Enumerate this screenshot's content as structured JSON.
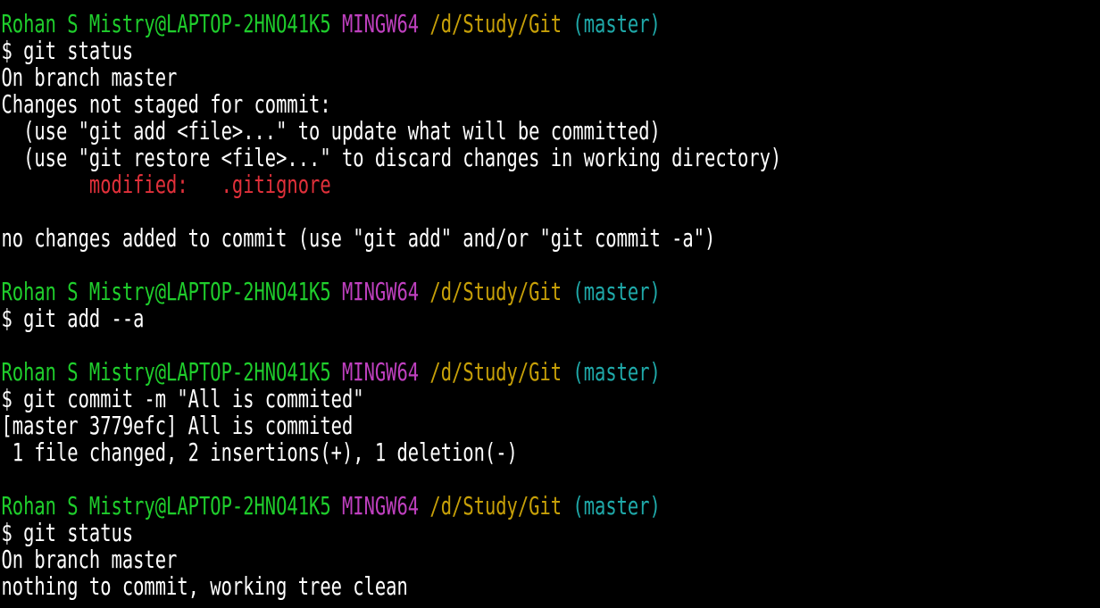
{
  "colors": {
    "background": "#000000",
    "text": "#ffffff",
    "user_host": "#1fce2c",
    "msystem": "#bf40bf",
    "path": "#c7a008",
    "branch": "#1fa9a9",
    "modified": "#e0303a"
  },
  "prompt": {
    "user_host": "Rohan S Mistry@LAPTOP-2HNO41K5",
    "msystem": "MINGW64",
    "path": "/d/Study/Git",
    "branch": "(master)"
  },
  "lines": {
    "l1": "$ git status",
    "l2": "On branch master",
    "l3": "Changes not staged for commit:",
    "l4": "  (use \"git add <file>...\" to update what will be committed)",
    "l5": "  (use \"git restore <file>...\" to discard changes in working directory)",
    "l6_label": "modified:",
    "l6_file": ".gitignore",
    "l7": "no changes added to commit (use \"git add\" and/or \"git commit -a\")",
    "l8": "$ git add --a",
    "l9": "$ git commit -m \"All is commited\"",
    "l10": "[master 3779efc] All is commited",
    "l11": " 1 file changed, 2 insertions(+), 1 deletion(-)",
    "l12": "$ git status",
    "l13": "On branch master",
    "l14": "nothing to commit, working tree clean"
  }
}
